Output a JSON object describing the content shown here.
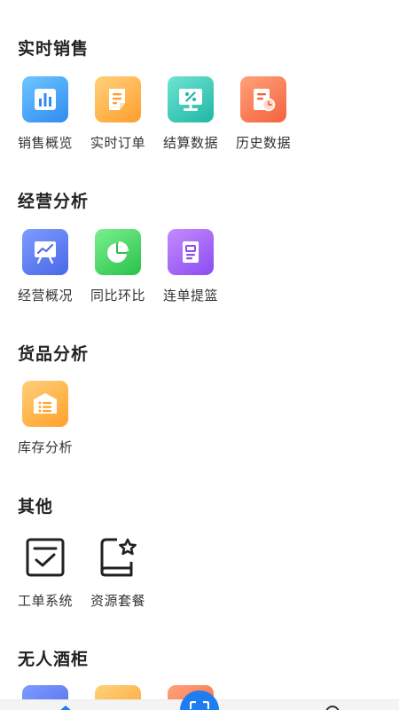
{
  "sections": [
    {
      "title": "实时销售",
      "items": [
        {
          "label": "销售概览"
        },
        {
          "label": "实时订单"
        },
        {
          "label": "结算数据"
        },
        {
          "label": "历史数据"
        }
      ]
    },
    {
      "title": "经营分析",
      "items": [
        {
          "label": "经营概况"
        },
        {
          "label": "同比环比"
        },
        {
          "label": "连单提篮"
        }
      ]
    },
    {
      "title": "货品分析",
      "items": [
        {
          "label": "库存分析"
        }
      ]
    },
    {
      "title": "其他",
      "items": [
        {
          "label": "工单系统"
        },
        {
          "label": "资源套餐"
        }
      ]
    },
    {
      "title": "无人酒柜",
      "items": []
    }
  ],
  "colors": {
    "accent": "#1e7ef0",
    "text": "#222222"
  },
  "icons": [
    "bar-chart-icon",
    "order-document-icon",
    "settlement-percent-icon",
    "history-clock-document-icon",
    "trend-board-icon",
    "pie-chart-icon",
    "connected-order-icon",
    "inventory-list-icon",
    "checklist-icon",
    "resource-book-star-icon",
    "scan-icon"
  ]
}
